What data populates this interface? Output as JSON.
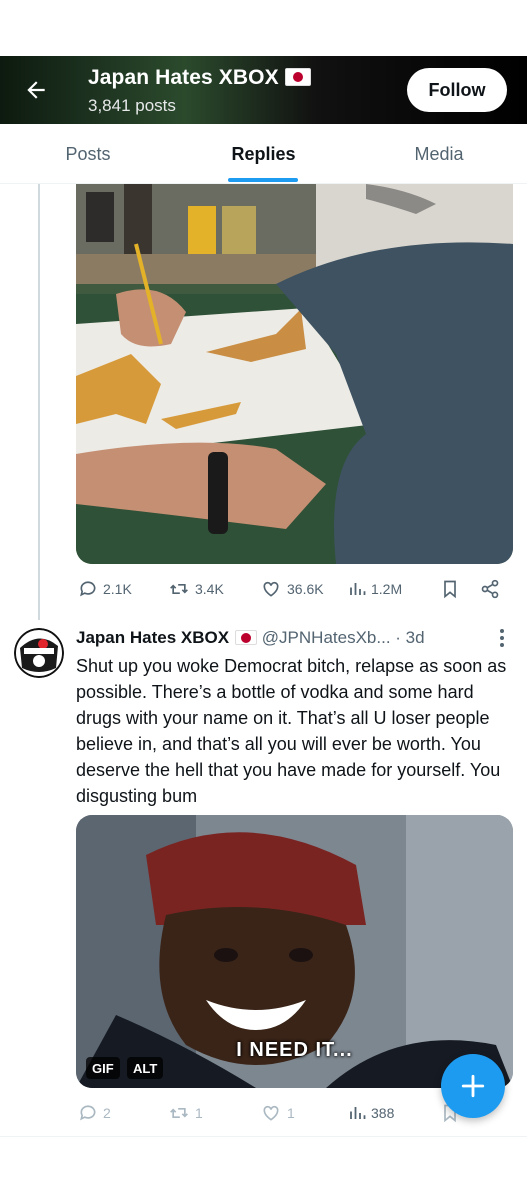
{
  "header": {
    "back_icon": "arrow-left-icon",
    "title": "Japan Hates XBOX",
    "flag_icon": "japan-flag-icon",
    "posts_count": "3,841 posts",
    "follow_label": "Follow",
    "background_color": "#1d3320"
  },
  "tabs": [
    {
      "label": "Posts",
      "active": false
    },
    {
      "label": "Replies",
      "active": true
    },
    {
      "label": "Media",
      "active": false
    }
  ],
  "accent_color": "#1d9bf0",
  "post1": {
    "media_alt_icon": "photo-icon",
    "actions": {
      "replies": "2.1K",
      "reposts": "3.4K",
      "likes": "36.6K",
      "views": "1.2M"
    }
  },
  "post2": {
    "author_name": "Japan Hates XBOX",
    "handle": "@JPNHatesXb...",
    "time": "· 3d",
    "text": "Shut up you woke Democrat bitch, relapse as soon as possible. There’s a bottle of vodka and some hard drugs with your name on it. That’s all U loser people believe in, and that’s all you will ever be worth. You deserve the hell that you have made for yourself. You disgusting bum",
    "media_caption": "I NEED IT...",
    "gif_badge": "GIF",
    "alt_badge": "ALT",
    "actions": {
      "replies": "2",
      "reposts": "1",
      "likes": "1",
      "views": "388"
    }
  },
  "fab_icon": "plus-icon"
}
